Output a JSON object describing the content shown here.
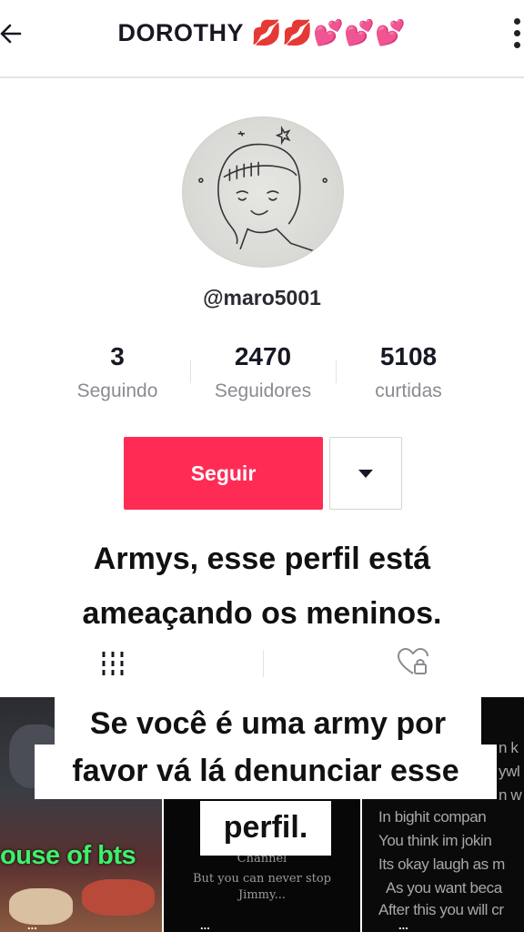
{
  "header": {
    "title": "DOROTHY",
    "title_emoji": "💋💋💕💕💕",
    "back_icon": "arrow-left-icon",
    "more_icon": "vertical-dots-icon"
  },
  "profile": {
    "handle": "@maro5001",
    "avatar_signature": "DOROTHY"
  },
  "stats": [
    {
      "value": "3",
      "label": "Seguindo"
    },
    {
      "value": "2470",
      "label": "Seguidores"
    },
    {
      "value": "5108",
      "label": "curtidas"
    }
  ],
  "actions": {
    "follow_label": "Seguir",
    "dropdown_icon": "caret-down-icon",
    "follow_color": "#fe2c55"
  },
  "captions": {
    "top_line1": "Armys, esse perfil está",
    "top_line2": "ameaçando os meninos.",
    "bottom_line1": "Se você é uma army por",
    "bottom_line2": "favor vá lá denunciar esse",
    "bottom_line3": "perfil."
  },
  "tabs": {
    "videos_icon": "grid-icon",
    "liked_icon": "locked-heart-icon"
  },
  "videos": [
    {
      "overlay_text": "ouse of bts",
      "views": "..."
    },
    {
      "lines": [
        "Channel",
        "But you can never stop",
        "Jimmy..."
      ],
      "views": "..."
    },
    {
      "lines": [
        "n k",
        "ywl",
        "n w",
        "In bighit compan",
        "You think im jokin",
        "Its okay laugh as m",
        "As you want beca",
        "After this you will cr"
      ],
      "views": "..."
    }
  ]
}
